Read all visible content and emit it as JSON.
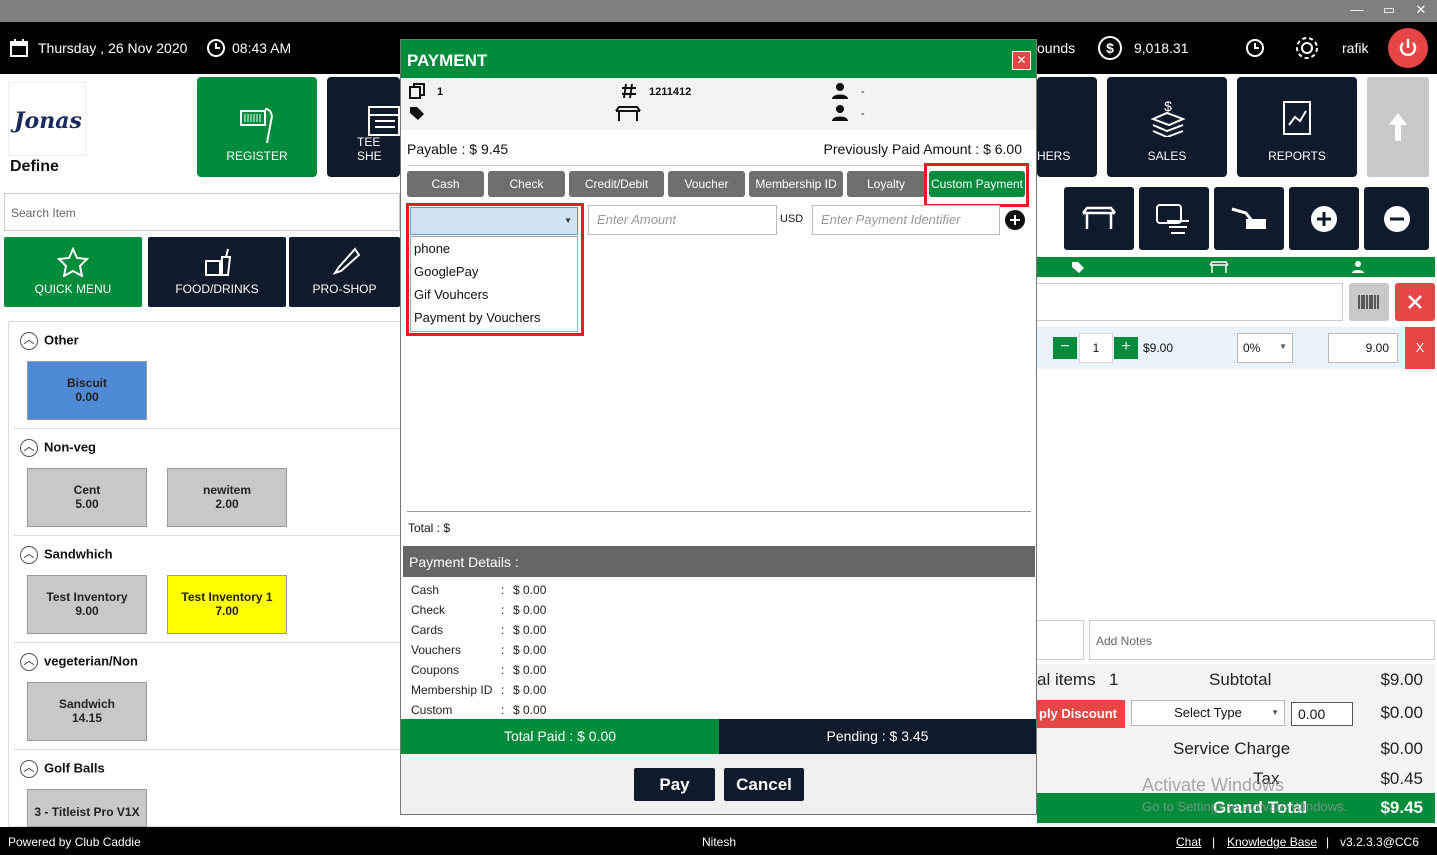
{
  "window": {
    "min": "—",
    "restore": "▭",
    "close": "✕"
  },
  "topbar": {
    "date": "Thursday ,  26 Nov 2020",
    "time": "08:43 AM",
    "rounds": "ounds",
    "balance": "9,018.31",
    "user": "rafik"
  },
  "left": {
    "define_label": "Define",
    "search_placeholder": "Search Item",
    "tiles": {
      "register": "REGISTER",
      "tee": "TEE SHE"
    },
    "categories": [
      {
        "label": "QUICK MENU"
      },
      {
        "label": "FOOD/DRINKS"
      },
      {
        "label": "PRO-SHOP"
      }
    ],
    "groups": [
      {
        "name": "Other",
        "items": [
          {
            "name": "Biscuit",
            "price": "0.00"
          }
        ]
      },
      {
        "name": "Non-veg",
        "items": [
          {
            "name": "Cent",
            "price": "5.00"
          },
          {
            "name": "newitem",
            "price": "2.00"
          }
        ]
      },
      {
        "name": "Sandwhich",
        "items": [
          {
            "name": "Test Inventory",
            "price": "9.00"
          },
          {
            "name": "Test Inventory 1",
            "price": "7.00"
          }
        ]
      },
      {
        "name": "vegeterian/Non",
        "items": [
          {
            "name": "Sandwich",
            "price": "14.15"
          }
        ]
      },
      {
        "name": "Golf Balls",
        "items": [
          {
            "name": "3 - Titleist Pro V1X",
            "price": ""
          }
        ]
      }
    ]
  },
  "right": {
    "tiles": {
      "vouchers": "HERS",
      "sales": "SALES",
      "reports": "REPORTS"
    },
    "line": {
      "qty": "1",
      "price": "$9.00",
      "discount": "0%",
      "amount": "9.00",
      "remove": "X"
    },
    "notes_placeholder": "Add Notes",
    "items_label": "al items",
    "items_count": "1",
    "subtotal_label": "Subtotal",
    "subtotal": "$9.00",
    "apply_discount": "ply Discount",
    "select_type": "Select Type",
    "discount_value": "0.00",
    "discount_amount": "$0.00",
    "service_label": "Service Charge",
    "service": "$0.00",
    "tax_label": "Tax",
    "tax": "$0.45",
    "grand_label": "Grand Total",
    "grand": "$9.45",
    "watermark1": "Activate Windows",
    "watermark2": "Go to Settings to activate Windows."
  },
  "modal": {
    "title": "PAYMENT",
    "close": "✕",
    "info": {
      "copies": "1",
      "check_no": "1211412",
      "person1": "-",
      "person2": "-"
    },
    "payable": "Payable : $ 9.45",
    "prev_paid": "Previously Paid Amount : $ 6.00",
    "methods": [
      "Cash",
      "Check",
      "Credit/Debit",
      "Voucher",
      "Membership ID",
      "Loyalty",
      "Custom Payment"
    ],
    "dropdown_options": [
      "phone",
      "GooglePay",
      "Gif Vouhcers",
      "Payment by Vouchers"
    ],
    "amount_placeholder": "Enter Amount",
    "currency": "USD",
    "identifier_placeholder": "Enter Payment Identifier",
    "total": "Total : $",
    "details_title": "Payment Details :",
    "details": [
      {
        "label": "Cash",
        "value": "$ 0.00"
      },
      {
        "label": "Check",
        "value": "$ 0.00"
      },
      {
        "label": "Cards",
        "value": "$ 0.00"
      },
      {
        "label": "Vouchers",
        "value": "$ 0.00"
      },
      {
        "label": "Coupons",
        "value": "$ 0.00"
      },
      {
        "label": "Membership ID",
        "value": "$ 0.00"
      },
      {
        "label": "Custom",
        "value": "$ 0.00"
      }
    ],
    "total_paid": "Total Paid : $ 0.00",
    "pending": "Pending : $ 3.45",
    "pay": "Pay",
    "cancel": "Cancel"
  },
  "footer": {
    "powered": "Powered by Club Caddie",
    "user": "Nitesh",
    "chat": "Chat",
    "kb": "Knowledge Base",
    "version": "v3.2.3.3@CC6"
  },
  "colors": {
    "green": "#008c3a",
    "navy": "#0f1a2a",
    "red": "#e02020",
    "blue_item": "#4f8ad6",
    "yellow_item": "#ffff00"
  }
}
